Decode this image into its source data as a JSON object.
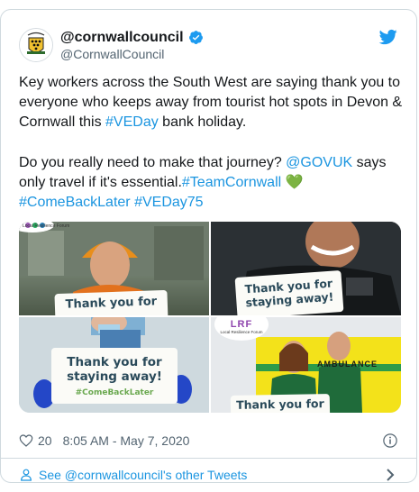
{
  "tweet": {
    "display_name": "@cornwallcouncil",
    "handle": "@CornwallCouncil",
    "text_line1_a": "Key workers across the South West are saying thank you to everyone who keeps away from tourist hot spots in Devon & Cornwall this ",
    "hashtag_veday": "#VEDay",
    "text_line1_b": " bank holiday.",
    "text_line2_a": "Do you really need to make that journey? ",
    "mention_govuk": "@GOVUK",
    "text_line2_b": " says only travel if it's essential.",
    "hashtag_teamcornwall": "#TeamCornwall",
    "emoji": "💚",
    "hashtag_comebacklater": "#ComeBackLater",
    "hashtag_veday75": "#VEDay75",
    "images": [
      {
        "sign_text": "Thank you for"
      },
      {
        "sign_text": "Thank you for staying away!"
      },
      {
        "sign_text": "Thank you for staying away!",
        "sign_subtext": "#ComeBackLater"
      },
      {
        "sign_text": "Thank you for",
        "logo_text": "Local Resilience Forum",
        "logo_letters": "LRF",
        "van_text": "AMBULANCE"
      }
    ],
    "logo_text_top": "Local Resilience Forum",
    "likes": "20",
    "timestamp": "8:05 AM - May 7, 2020",
    "more_tweets": "See @cornwallcouncil's other Tweets"
  },
  "colors": {
    "link": "#1b95e0",
    "verified": "#1d9bf0",
    "border": "#cfd9de",
    "secondary_text": "#536471"
  },
  "icons": [
    "council-crest-icon",
    "verified-badge-icon",
    "twitter-bird-icon",
    "heart-icon",
    "info-icon",
    "person-icon",
    "chevron-right-icon"
  ]
}
